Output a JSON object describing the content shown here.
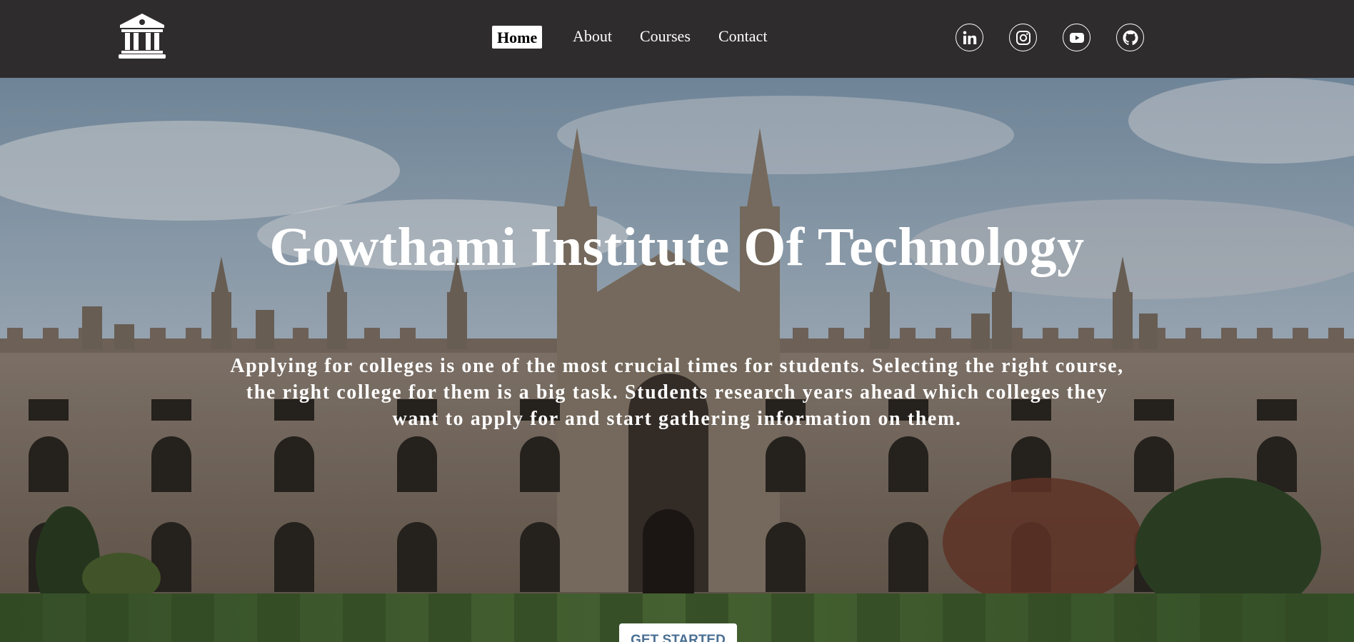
{
  "header": {
    "logo_icon": "institution-building-icon",
    "nav": [
      {
        "label": "Home",
        "active": true
      },
      {
        "label": "About",
        "active": false
      },
      {
        "label": "Courses",
        "active": false
      },
      {
        "label": "Contact",
        "active": false
      }
    ],
    "social": [
      {
        "icon": "linkedin-icon"
      },
      {
        "icon": "instagram-icon"
      },
      {
        "icon": "youtube-icon"
      },
      {
        "icon": "github-icon"
      }
    ]
  },
  "hero": {
    "title": "Gowthami Institute Of Technology",
    "description": "Applying for colleges is one of the most crucial times for students. Selecting the right course, the right college for them is a big task. Students research years ahead which colleges they want to apply for and start gathering information on them.",
    "cta_label": "GET STARTED"
  },
  "colors": {
    "navbar": "#2f2c2d",
    "nav_text": "#ffffff",
    "active_nav_bg": "#ffffff",
    "cta_text": "#4a6f93"
  }
}
